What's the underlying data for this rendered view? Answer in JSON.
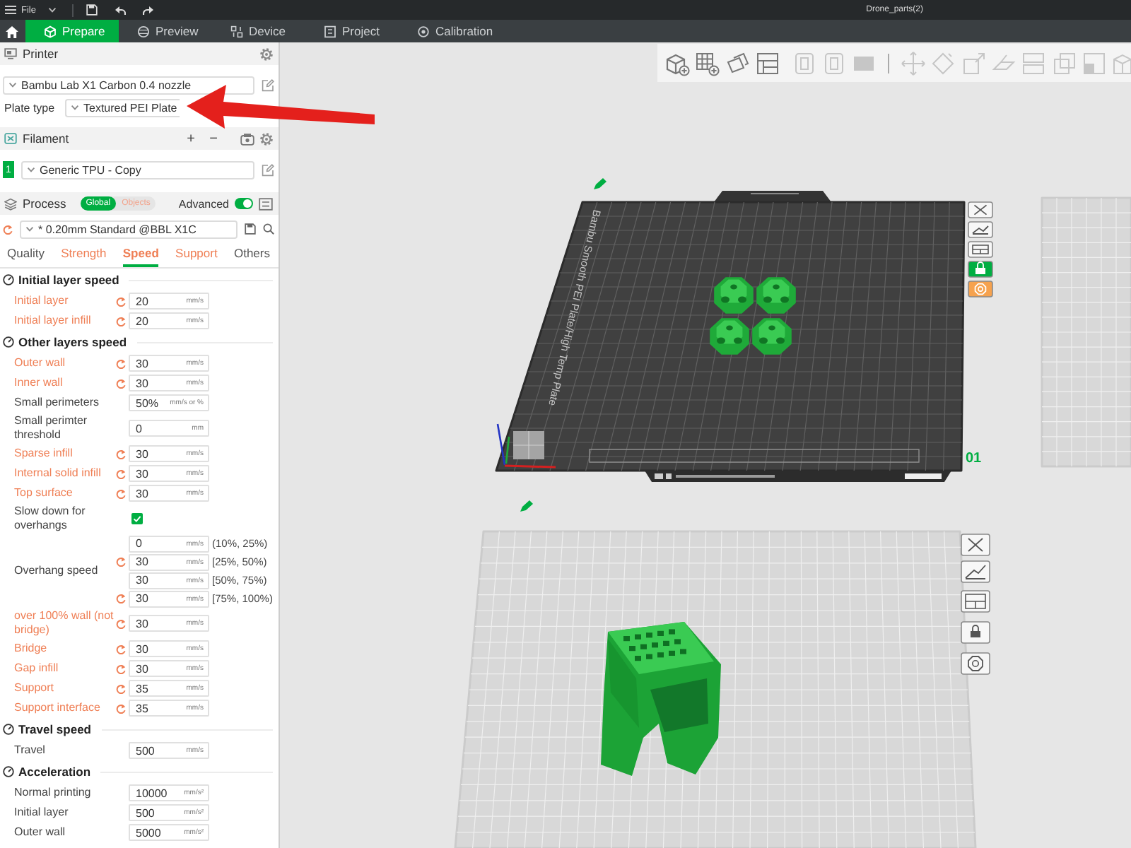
{
  "title_bar": {
    "menu": "File",
    "title": "Drone_parts(2)"
  },
  "tabs": [
    {
      "label": "Prepare",
      "selected": true
    },
    {
      "label": "Preview",
      "selected": false
    },
    {
      "label": "Device",
      "selected": false
    },
    {
      "label": "Project",
      "selected": false
    },
    {
      "label": "Calibration",
      "selected": false
    }
  ],
  "printer": {
    "title": "Printer",
    "preset": "Bambu Lab X1 Carbon 0.4 nozzle",
    "plate_type_label": "Plate type",
    "plate_type": "Textured PEI Plate"
  },
  "filament": {
    "title": "Filament",
    "add": "+",
    "remove": "−",
    "items": [
      {
        "index": "1",
        "name": "Generic TPU - Copy",
        "color": "#00ae42"
      }
    ]
  },
  "process": {
    "title": "Process",
    "scope": [
      {
        "label": "Global",
        "selected": true
      },
      {
        "label": "Objects",
        "selected": false
      }
    ],
    "advanced_label": "Advanced",
    "advanced": true,
    "preset": "* 0.20mm Standard @BBL X1C",
    "modified": true
  },
  "setting_tabs": [
    {
      "label": "Quality",
      "selected": false,
      "modified": false
    },
    {
      "label": "Strength",
      "selected": false,
      "modified": true
    },
    {
      "label": "Speed",
      "selected": true,
      "modified": true
    },
    {
      "label": "Support",
      "selected": false,
      "modified": true
    },
    {
      "label": "Others",
      "selected": false,
      "modified": false
    }
  ],
  "settings": [
    {
      "kind": "header",
      "label": "Initial layer speed"
    },
    {
      "kind": "field",
      "label": "Initial layer",
      "modified": true,
      "value": "20",
      "unit": "mm/s"
    },
    {
      "kind": "field",
      "label": "Initial layer infill",
      "modified": true,
      "value": "20",
      "unit": "mm/s"
    },
    {
      "kind": "header",
      "label": "Other layers speed"
    },
    {
      "kind": "field",
      "label": "Outer wall",
      "modified": true,
      "value": "30",
      "unit": "mm/s"
    },
    {
      "kind": "field",
      "label": "Inner wall",
      "modified": true,
      "value": "30",
      "unit": "mm/s"
    },
    {
      "kind": "field",
      "label": "Small perimeters",
      "modified": false,
      "value": "50%",
      "unit": "mm/s or %"
    },
    {
      "kind": "field",
      "label": "Small perimter threshold",
      "modified": false,
      "value": "0",
      "unit": "mm"
    },
    {
      "kind": "field",
      "label": "Sparse infill",
      "modified": true,
      "value": "30",
      "unit": "mm/s"
    },
    {
      "kind": "field",
      "label": "Internal solid infill",
      "modified": true,
      "value": "30",
      "unit": "mm/s"
    },
    {
      "kind": "field",
      "label": "Top surface",
      "modified": true,
      "value": "30",
      "unit": "mm/s"
    },
    {
      "kind": "check",
      "label": "Slow down for overhangs",
      "modified": false,
      "checked": true
    },
    {
      "kind": "group",
      "label": "Overhang speed",
      "modified": false,
      "items": [
        {
          "value": "0",
          "unit": "mm/s",
          "range": "(10%, 25%)",
          "modified": false
        },
        {
          "value": "30",
          "unit": "mm/s",
          "range": "[25%, 50%)",
          "modified": true
        },
        {
          "value": "30",
          "unit": "mm/s",
          "range": "[50%, 75%)",
          "modified": false
        },
        {
          "value": "30",
          "unit": "mm/s",
          "range": "[75%, 100%)",
          "modified": true
        }
      ]
    },
    {
      "kind": "field",
      "label": "over 100% wall (not bridge)",
      "modified": true,
      "value": "30",
      "unit": "mm/s"
    },
    {
      "kind": "field",
      "label": "Bridge",
      "modified": true,
      "value": "30",
      "unit": "mm/s"
    },
    {
      "kind": "field",
      "label": "Gap infill",
      "modified": true,
      "value": "30",
      "unit": "mm/s"
    },
    {
      "kind": "field",
      "label": "Support",
      "modified": true,
      "value": "35",
      "unit": "mm/s"
    },
    {
      "kind": "field",
      "label": "Support interface",
      "modified": true,
      "value": "35",
      "unit": "mm/s"
    },
    {
      "kind": "header",
      "label": "Travel speed"
    },
    {
      "kind": "field",
      "label": "Travel",
      "modified": false,
      "value": "500",
      "unit": "mm/s"
    },
    {
      "kind": "header",
      "label": "Acceleration"
    },
    {
      "kind": "field",
      "label": "Normal printing",
      "modified": false,
      "value": "10000",
      "unit": "mm/s²"
    },
    {
      "kind": "field",
      "label": "Initial layer",
      "modified": false,
      "value": "500",
      "unit": "mm/s²"
    },
    {
      "kind": "field",
      "label": "Outer wall",
      "modified": false,
      "value": "5000",
      "unit": "mm/s²"
    }
  ],
  "viewport": {
    "toolbar": [
      {
        "disabled": false
      },
      {
        "disabled": false
      },
      {
        "disabled": false
      },
      {
        "disabled": false
      },
      {
        "disabled": true
      },
      {
        "disabled": true
      },
      {
        "disabled": true
      },
      {
        "disabled": true
      },
      {
        "disabled": true
      },
      {
        "disabled": true
      },
      {
        "disabled": true
      },
      {
        "disabled": true
      },
      {
        "disabled": true
      },
      {
        "disabled": true
      },
      {
        "disabled": true
      }
    ],
    "plates": [
      {
        "number": "01",
        "label": "Bambu Smooth PEI Plate/High Temp Plate",
        "selected": true,
        "locked": true,
        "custom_settings": true
      },
      {
        "selected": false,
        "locked": false,
        "custom_settings": false
      },
      {
        "selected": false
      }
    ]
  }
}
